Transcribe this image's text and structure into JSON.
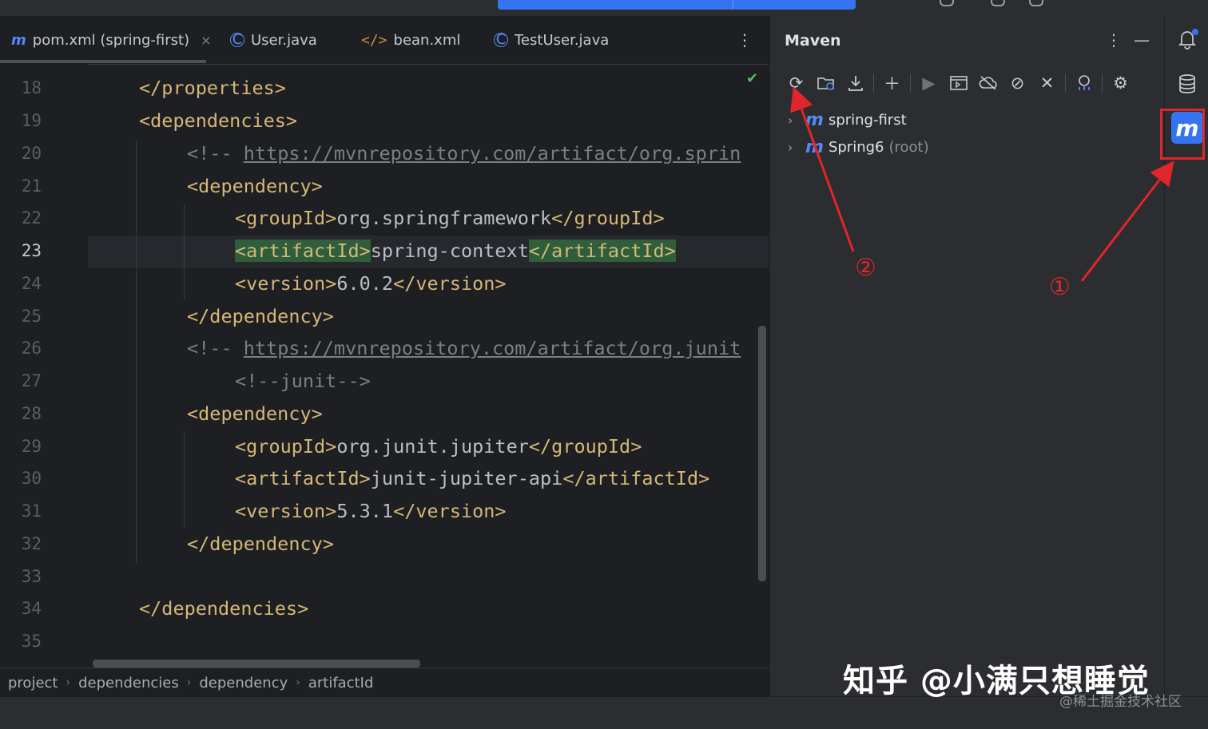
{
  "tabs": [
    {
      "label": "pom.xml (spring-first)",
      "icon": "maven-m-icon",
      "active": true,
      "closable": true
    },
    {
      "label": "User.java",
      "icon": "class-icon"
    },
    {
      "label": "bean.xml",
      "icon": "xml-icon"
    },
    {
      "label": "TestUser.java",
      "icon": "class-icon"
    }
  ],
  "line_numbers": [
    "18",
    "19",
    "20",
    "21",
    "22",
    "23",
    "24",
    "25",
    "26",
    "27",
    "28",
    "29",
    "30",
    "31",
    "32",
    "33",
    "34",
    "35"
  ],
  "code": {
    "l18": "</properties>",
    "l19": "<dependencies>",
    "l20_prefix": "<!-- ",
    "l20_url": "https://mvnrepository.com/artifact/org.sprin",
    "l21": "<dependency>",
    "l22_open": "<groupId>",
    "l22_val": "org.springframework",
    "l22_close": "</groupId>",
    "l23_open": "<artifactId>",
    "l23_val": "spring-context",
    "l23_close": "</artifactId>",
    "l24_open": "<version>",
    "l24_val": "6.0.2",
    "l24_close": "</version>",
    "l25": "</dependency>",
    "l26_prefix": "<!-- ",
    "l26_url": "https://mvnrepository.com/artifact/org.junit",
    "l27": "<!--junit-->",
    "l28": "<dependency>",
    "l29_open": "<groupId>",
    "l29_val": "org.junit.jupiter",
    "l29_close": "</groupId>",
    "l30_open": "<artifactId>",
    "l30_val": "junit-jupiter-api",
    "l30_close": "</artifactId>",
    "l31_open": "<version>",
    "l31_val": "5.3.1",
    "l31_close": "</version>",
    "l32": "</dependency>",
    "l34": "</dependencies>"
  },
  "breadcrumb": [
    "project",
    "dependencies",
    "dependency",
    "artifactId"
  ],
  "maven": {
    "title": "Maven",
    "toolbar": [
      "reload-icon",
      "add-folder-icon",
      "download-icon",
      "plus-icon",
      "run-icon",
      "execute-goal-icon",
      "offline-icon",
      "skip-tests-icon",
      "collapse-icon",
      "analyze-icon",
      "settings-icon"
    ],
    "projects": [
      {
        "name": "spring-first",
        "suffix": ""
      },
      {
        "name": "Spring6",
        "suffix": "(root)"
      }
    ]
  },
  "annotations": {
    "marker_1": "①",
    "marker_2": "②",
    "color": "#e0262a"
  },
  "watermark": {
    "main": "知乎 @小满只想睡觉",
    "sub": "@稀土掘金技术社区"
  }
}
